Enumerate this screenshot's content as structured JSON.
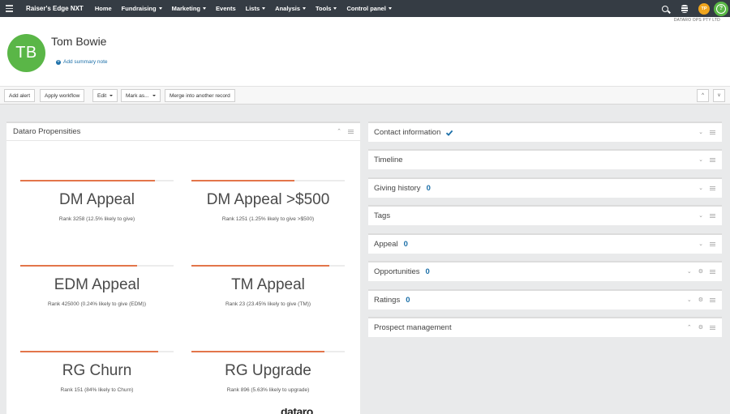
{
  "nav": {
    "brand": "Raiser's Edge NXT",
    "items": [
      {
        "label": "Home",
        "dropdown": false
      },
      {
        "label": "Fundraising",
        "dropdown": true
      },
      {
        "label": "Marketing",
        "dropdown": true
      },
      {
        "label": "Events",
        "dropdown": false
      },
      {
        "label": "Lists",
        "dropdown": true
      },
      {
        "label": "Analysis",
        "dropdown": true
      },
      {
        "label": "Tools",
        "dropdown": true
      },
      {
        "label": "Control panel",
        "dropdown": true
      }
    ],
    "user_initials": "TP",
    "help_symbol": "?",
    "icons": [
      "hamburger-menu-icon",
      "search-icon",
      "database-icon",
      "help-icon"
    ]
  },
  "org_name": "DATARO OPS PTY LTD",
  "record": {
    "initials": "TB",
    "name": "Tom Bowie",
    "summary_note": "Add summary note",
    "avatar_color": "#5ab647"
  },
  "toolbar": {
    "add_alert": "Add alert",
    "apply_workflow": "Apply workflow",
    "edit": "Edit",
    "mark_as": "Mark as...",
    "merge": "Merge into another record",
    "up": "^",
    "down": "v"
  },
  "propensities": {
    "title": "Dataro Propensities",
    "accent_color": "#e3754a",
    "items": [
      {
        "title": "DM Appeal",
        "rank": "Rank 3258 (12.5% likely to give)",
        "score": 0.88
      },
      {
        "title": "DM Appeal >$500",
        "rank": "Rank 1251 (1.25% likely to give >$500)",
        "score": 0.67
      },
      {
        "title": "EDM Appeal",
        "rank": "Rank 425000 (0.24% likely to give (EDM))",
        "score": 0.76
      },
      {
        "title": "TM Appeal",
        "rank": "Rank 23 (23.45% likely to give (TM))",
        "score": 0.9
      },
      {
        "title": "RG Churn",
        "rank": "Rank 151 (84% likely to Churn)",
        "score": 0.9
      },
      {
        "title": "RG Upgrade",
        "rank": "Rank 896 (5.63% likely to upgrade)",
        "score": 0.87
      }
    ]
  },
  "tiles": [
    {
      "title": "Contact information",
      "count": "",
      "check": true,
      "gear": false,
      "chevron": "down"
    },
    {
      "title": "Timeline",
      "count": "",
      "check": false,
      "gear": false,
      "chevron": "down"
    },
    {
      "title": "Giving history",
      "count": "0",
      "check": false,
      "gear": false,
      "chevron": "down"
    },
    {
      "title": "Tags",
      "count": "",
      "check": false,
      "gear": false,
      "chevron": "down"
    },
    {
      "title": "Appeal",
      "count": "0",
      "check": false,
      "gear": false,
      "chevron": "down"
    },
    {
      "title": "Opportunities",
      "count": "0",
      "check": false,
      "gear": true,
      "chevron": "down"
    },
    {
      "title": "Ratings",
      "count": "0",
      "check": false,
      "gear": true,
      "chevron": "down"
    },
    {
      "title": "Prospect management",
      "count": "",
      "check": false,
      "gear": true,
      "chevron": "up"
    }
  ],
  "watermark": "dataro"
}
